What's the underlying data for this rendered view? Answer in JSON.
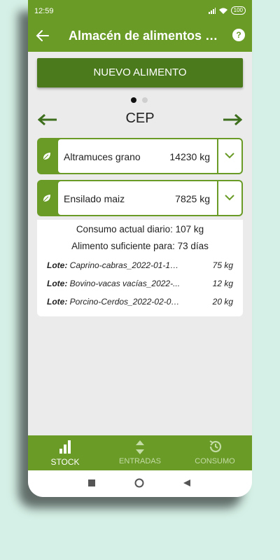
{
  "status_bar": {
    "time": "12:59",
    "battery": "100"
  },
  "app_bar": {
    "title": "Almacén de alimentos - S..."
  },
  "main": {
    "new_button": "NUEVO ALIMENTO",
    "section_title": "CEP",
    "page_indicator": {
      "pages": 2,
      "current": 1
    },
    "items": [
      {
        "name": "Altramuces grano",
        "quantity": "14230 kg"
      },
      {
        "name": "Ensilado maiz",
        "quantity": "7825 kg"
      }
    ],
    "details": {
      "consumption": "Consumo actual diario: 107 kg",
      "sufficient": "Alimento suficiente para: 73 días",
      "lots": [
        {
          "label": "Lote:",
          "name": "Caprino-cabras_2022-01-10...",
          "qty": "75 kg"
        },
        {
          "label": "Lote:",
          "name": "Bovino-vacas vacías_2022-...",
          "qty": "12 kg"
        },
        {
          "label": "Lote:",
          "name": "Porcino-Cerdos_2022-02-03...",
          "qty": "20 kg"
        }
      ]
    }
  },
  "tabs": [
    {
      "label": "STOCK",
      "icon": "bar-chart-icon",
      "active": true
    },
    {
      "label": "ENTRADAS",
      "icon": "sort-arrows-icon",
      "active": false
    },
    {
      "label": "CONSUMO",
      "icon": "history-icon",
      "active": false
    }
  ],
  "colors": {
    "primary": "#6a9b27",
    "button_dark": "#4a7a1c",
    "background": "#d5f0e6",
    "content_bg": "#ebebeb"
  }
}
